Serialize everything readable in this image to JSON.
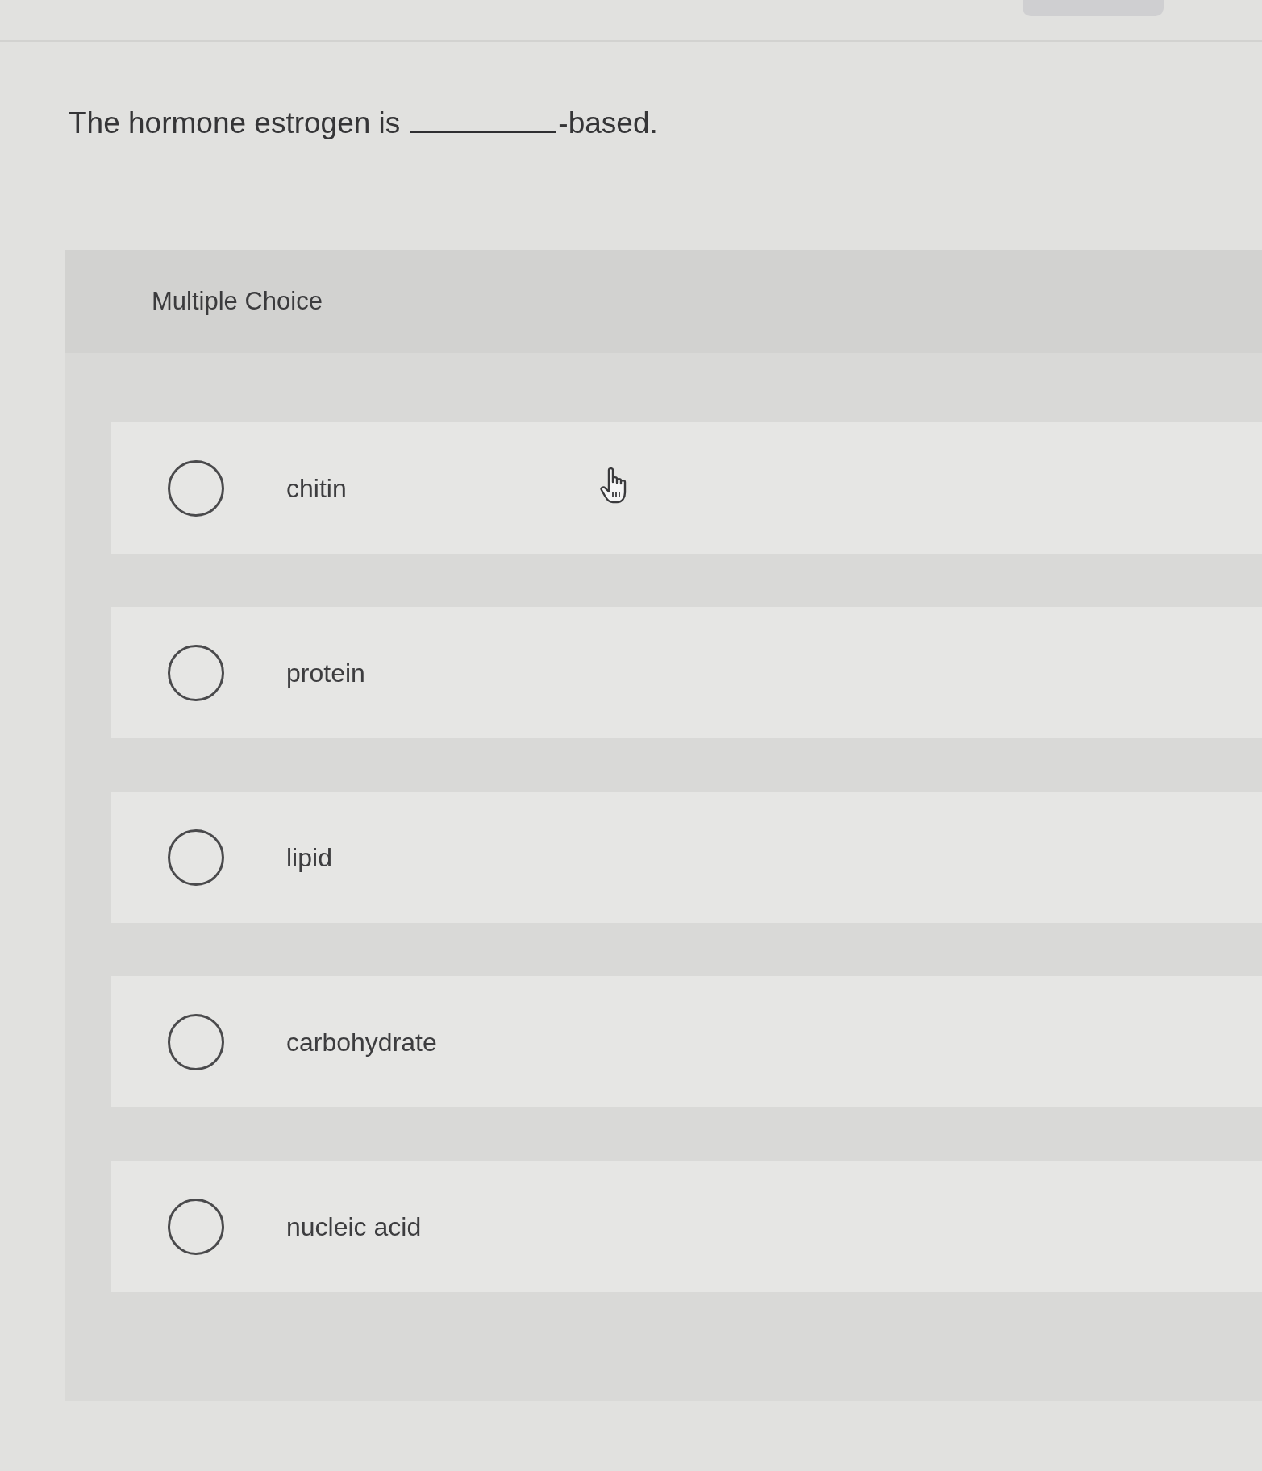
{
  "question": {
    "before": "The hormone estrogen is",
    "after": "-based."
  },
  "section": {
    "title": "Multiple Choice"
  },
  "options": [
    {
      "label": "chitin",
      "selected": false
    },
    {
      "label": "protein",
      "selected": false
    },
    {
      "label": "lipid",
      "selected": false
    },
    {
      "label": "carbohydrate",
      "selected": false
    },
    {
      "label": "nucleic acid",
      "selected": false
    }
  ]
}
